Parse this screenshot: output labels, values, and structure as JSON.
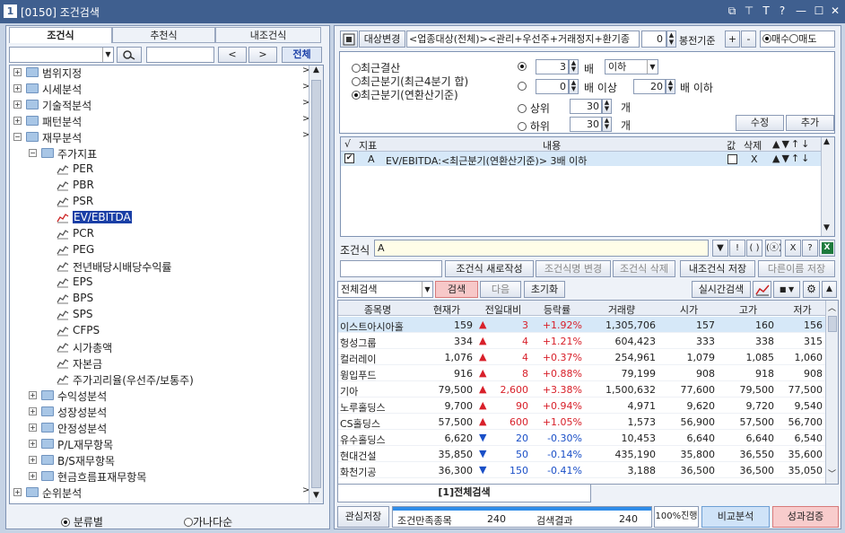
{
  "window": {
    "num": "1",
    "title": "[0150] 조건검색",
    "btn_icons": [
      "restore-icon",
      "pin-icon",
      "font-icon",
      "help-icon",
      "minimize-icon",
      "maximize-icon",
      "close-icon"
    ],
    "btn_glyphs": [
      "⧉",
      "⊤",
      "T",
      "?",
      "—",
      "☐",
      "✕"
    ]
  },
  "left": {
    "tabs": [
      "조건식",
      "추천식",
      "내조건식"
    ],
    "search_btns": {
      "prev": "<",
      "next": ">",
      "all": "전체"
    },
    "tree": [
      {
        "label": "범위지정",
        "level": 0,
        "type": "folder",
        "expand": "+",
        "arrow": ">"
      },
      {
        "label": "시세분석",
        "level": 0,
        "type": "folder",
        "expand": "+",
        "arrow": ">"
      },
      {
        "label": "기술적분석",
        "level": 0,
        "type": "folder",
        "expand": "+",
        "arrow": ">"
      },
      {
        "label": "패턴분석",
        "level": 0,
        "type": "folder",
        "expand": "+",
        "arrow": ">"
      },
      {
        "label": "재무분석",
        "level": 0,
        "type": "folder",
        "expand": "−",
        "arrow": ">"
      },
      {
        "label": "주가지표",
        "level": 1,
        "type": "folder",
        "expand": "−",
        "arrow": ""
      },
      {
        "label": "PER",
        "level": 2,
        "type": "leaf",
        "expand": "",
        "arrow": ""
      },
      {
        "label": "PBR",
        "level": 2,
        "type": "leaf",
        "expand": "",
        "arrow": ""
      },
      {
        "label": "PSR",
        "level": 2,
        "type": "leaf",
        "expand": "",
        "arrow": ""
      },
      {
        "label": "EV/EBITDA",
        "level": 2,
        "type": "leaf",
        "expand": "",
        "arrow": "",
        "selected": true
      },
      {
        "label": "PCR",
        "level": 2,
        "type": "leaf",
        "expand": "",
        "arrow": ""
      },
      {
        "label": "PEG",
        "level": 2,
        "type": "leaf",
        "expand": "",
        "arrow": ""
      },
      {
        "label": "전년배당시배당수익률",
        "level": 2,
        "type": "leaf",
        "expand": "",
        "arrow": ""
      },
      {
        "label": "EPS",
        "level": 2,
        "type": "leaf",
        "expand": "",
        "arrow": ""
      },
      {
        "label": "BPS",
        "level": 2,
        "type": "leaf",
        "expand": "",
        "arrow": ""
      },
      {
        "label": "SPS",
        "level": 2,
        "type": "leaf",
        "expand": "",
        "arrow": ""
      },
      {
        "label": "CFPS",
        "level": 2,
        "type": "leaf",
        "expand": "",
        "arrow": ""
      },
      {
        "label": "시가총액",
        "level": 2,
        "type": "leaf",
        "expand": "",
        "arrow": ""
      },
      {
        "label": "자본금",
        "level": 2,
        "type": "leaf",
        "expand": "",
        "arrow": ""
      },
      {
        "label": "주가괴리율(우선주/보통주)",
        "level": 2,
        "type": "leaf",
        "expand": "",
        "arrow": ""
      },
      {
        "label": "수익성분석",
        "level": 1,
        "type": "folder",
        "expand": "+",
        "arrow": ""
      },
      {
        "label": "성장성분석",
        "level": 1,
        "type": "folder",
        "expand": "+",
        "arrow": ""
      },
      {
        "label": "안정성분석",
        "level": 1,
        "type": "folder",
        "expand": "+",
        "arrow": ""
      },
      {
        "label": "P/L재무항목",
        "level": 1,
        "type": "folder",
        "expand": "+",
        "arrow": ""
      },
      {
        "label": "B/S재무항목",
        "level": 1,
        "type": "folder",
        "expand": "+",
        "arrow": ""
      },
      {
        "label": "현금흐름표재무항목",
        "level": 1,
        "type": "folder",
        "expand": "+",
        "arrow": ""
      },
      {
        "label": "순위분석",
        "level": 0,
        "type": "folder",
        "expand": "+",
        "arrow": ">"
      }
    ],
    "radio_category": "분류별",
    "radio_alpha": "가나다순"
  },
  "right": {
    "toolbar": {
      "target_btn": "대상변경",
      "target_text": "<업종대상(전체)><관리+우선주+거래정지+환기종",
      "num": "0",
      "bong": "봉전기준",
      "plus": "+",
      "minus": "-",
      "buy": "매수",
      "sell": "매도"
    },
    "period": [
      "최근결산",
      "최근분기(최근4분기 합)",
      "최근분기(연환산기준)"
    ],
    "cond1": {
      "value": "3",
      "unit": "배",
      "op": "이하"
    },
    "cond2": {
      "v1": "0",
      "t1": "배 이상",
      "v2": "20",
      "t2": "배 이하"
    },
    "cond3": {
      "label": "상위",
      "value": "30",
      "unit": "개"
    },
    "cond4": {
      "label": "하위",
      "value": "30",
      "unit": "개"
    },
    "edit_btn": "수정",
    "add_btn": "추가",
    "list_hdr": {
      "check": "√",
      "idx": "지표",
      "content": "내용",
      "val": "값",
      "del": "삭제"
    },
    "list_row": {
      "idx": "A",
      "content": "EV/EBITDA:<최근분기(연환산기준)> 3배 이하",
      "del": "X"
    },
    "formula": {
      "label": "조건식",
      "value": "A",
      "btns": [
        "▼",
        "!",
        "( )",
        "(ⓧ)",
        "X",
        "?"
      ]
    },
    "actions": [
      "조건식 새로작성",
      "조건식명 변경",
      "조건식 삭제",
      "내조건식 저장",
      "다른이름 저장"
    ],
    "search": {
      "select": "전체검색",
      "search": "검색",
      "next": "다음",
      "reset": "초기화",
      "realtime": "실시간검색"
    },
    "grid_cols": [
      "종목명",
      "현재가",
      "전일대비",
      "등락률",
      "거래량",
      "시가",
      "고가",
      "저가"
    ],
    "rows": [
      [
        "이스트아시아홀",
        "159",
        "up",
        "3",
        "+1.92%",
        "1,305,706",
        "157",
        "160",
        "156"
      ],
      [
        "헝성그룹",
        "334",
        "up",
        "4",
        "+1.21%",
        "604,423",
        "333",
        "338",
        "315"
      ],
      [
        "컬러레이",
        "1,076",
        "up",
        "4",
        "+0.37%",
        "254,961",
        "1,079",
        "1,085",
        "1,060"
      ],
      [
        "윙입푸드",
        "916",
        "up",
        "8",
        "+0.88%",
        "79,199",
        "908",
        "918",
        "908"
      ],
      [
        "기아",
        "79,500",
        "up",
        "2,600",
        "+3.38%",
        "1,500,632",
        "77,600",
        "79,500",
        "77,500"
      ],
      [
        "노루홀딩스",
        "9,700",
        "up",
        "90",
        "+0.94%",
        "4,971",
        "9,620",
        "9,720",
        "9,540"
      ],
      [
        "CS홀딩스",
        "57,500",
        "up",
        "600",
        "+1.05%",
        "1,573",
        "56,900",
        "57,500",
        "56,700"
      ],
      [
        "유수홀딩스",
        "6,620",
        "dn",
        "20",
        "-0.30%",
        "10,453",
        "6,640",
        "6,640",
        "6,540"
      ],
      [
        "현대건설",
        "35,850",
        "dn",
        "50",
        "-0.14%",
        "435,190",
        "35,800",
        "36,550",
        "35,600"
      ],
      [
        "화천기공",
        "36,300",
        "dn",
        "150",
        "-0.41%",
        "3,188",
        "36,500",
        "36,500",
        "35,050"
      ]
    ],
    "bottom_tab": "[1]전체검색",
    "status": {
      "save": "관심저장",
      "match_label": "조건만족종목",
      "match": "240",
      "result_label": "검색결과",
      "result": "240",
      "progress": "100%진행",
      "progress_value": 100,
      "compare": "비교분석",
      "verify": "성과검증"
    },
    "colors": {
      "up": "#d8202a",
      "down": "#1a4fc7",
      "highlight": "#d6e8f8",
      "selected": "#1a3fa6"
    }
  }
}
